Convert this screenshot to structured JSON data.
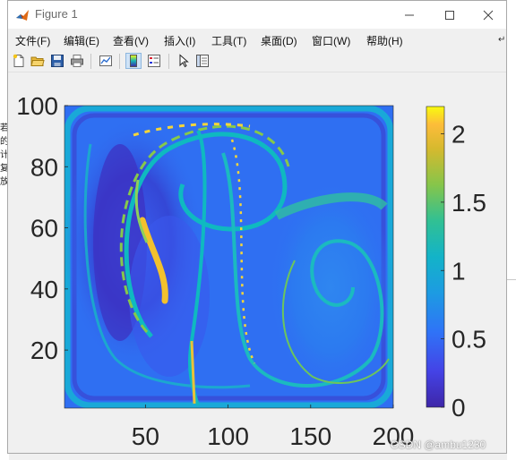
{
  "window": {
    "title": "Figure 1"
  },
  "menu": {
    "items": [
      "文件(F)",
      "编辑(E)",
      "查看(V)",
      "插入(I)",
      "工具(T)",
      "桌面(D)",
      "窗口(W)",
      "帮助(H)"
    ]
  },
  "toolbar": {
    "buttons": [
      "new-figure",
      "open-file",
      "save",
      "print",
      "link-plot",
      "insert-colorbar",
      "insert-legend",
      "edit-plot",
      "property-inspector"
    ]
  },
  "chart_data": {
    "type": "heatmap",
    "colormap": "parula",
    "x_ticks": [
      "50",
      "100",
      "150",
      "200"
    ],
    "x_tick_values": [
      50,
      100,
      150,
      200
    ],
    "y_ticks": [
      "20",
      "40",
      "60",
      "80",
      "100"
    ],
    "y_tick_values": [
      20,
      40,
      60,
      80,
      100
    ],
    "xlim": [
      1,
      200
    ],
    "ylim": [
      1,
      100
    ],
    "colorbar": {
      "ticks": [
        "0",
        "0.5",
        "1",
        "1.5",
        "2"
      ],
      "tick_values": [
        0,
        0.5,
        1,
        1.5,
        2
      ],
      "range": [
        0,
        2.2
      ]
    }
  },
  "background": {
    "left_snippet": "若的计复放"
  },
  "watermark": "CSDN @ambu1230"
}
